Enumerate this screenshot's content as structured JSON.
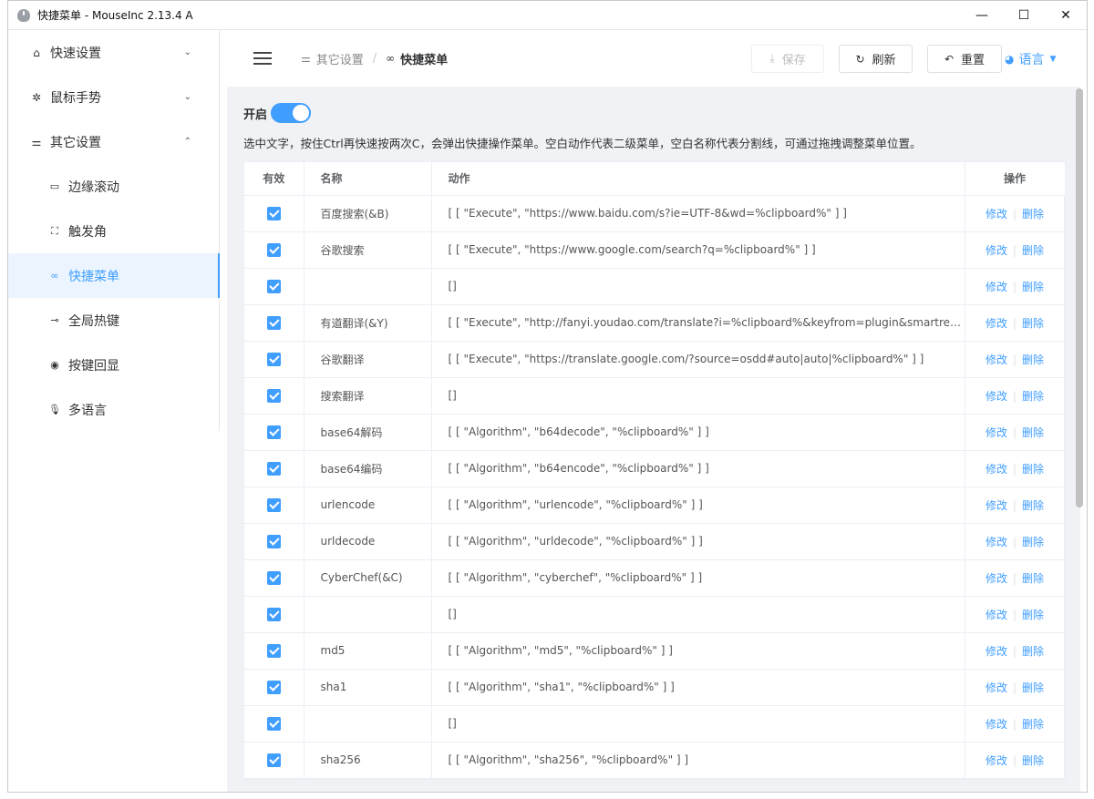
{
  "window": {
    "title": "快捷菜单 - MouseInc 2.13.4 A",
    "min": "—",
    "max": "☐",
    "close": "✕"
  },
  "sidebar": {
    "items": [
      {
        "label": "快速设置",
        "icon": "home-icon",
        "glyph": "⌂",
        "chevron": "⌄"
      },
      {
        "label": "鼠标手势",
        "icon": "gear-icon",
        "glyph": "✲",
        "chevron": "⌄"
      },
      {
        "label": "其它设置",
        "icon": "sliders-icon",
        "glyph": "⚌",
        "chevron": "⌃"
      }
    ],
    "subitems": [
      {
        "label": "边缘滚动",
        "icon": "monitor-icon",
        "glyph": "▭"
      },
      {
        "label": "触发角",
        "icon": "corners-icon",
        "glyph": "⛶"
      },
      {
        "label": "快捷菜单",
        "icon": "link-icon",
        "glyph": "∞"
      },
      {
        "label": "全局热键",
        "icon": "key-icon",
        "glyph": "⊸"
      },
      {
        "label": "按键回显",
        "icon": "eye-icon",
        "glyph": "◉"
      },
      {
        "label": "多语言",
        "icon": "microphone-icon",
        "glyph": "🎙"
      }
    ]
  },
  "header": {
    "breadcrumb": {
      "parent": "其它设置",
      "current": "快捷菜单",
      "separator": "/"
    },
    "buttons": {
      "save": "保存",
      "refresh": "刷新",
      "reset": "重置"
    },
    "language": "语言"
  },
  "main": {
    "toggle_label": "开启",
    "toggle_on": true,
    "description": "选中文字，按住Ctrl再快速按两次C，会弹出快捷操作菜单。空白动作代表二级菜单，空白名称代表分割线，可通过拖拽调整菜单位置。",
    "table": {
      "headers": {
        "valid": "有效",
        "name": "名称",
        "action": "动作",
        "ops": "操作"
      },
      "edit_label": "修改",
      "delete_label": "删除",
      "rows": [
        {
          "name": "百度搜索(&B)",
          "action": "[ [ \"Execute\", \"https://www.baidu.com/s?ie=UTF-8&wd=%clipboard%\" ] ]"
        },
        {
          "name": "谷歌搜索",
          "action": "[ [ \"Execute\", \"https://www.google.com/search?q=%clipboard%\" ] ]"
        },
        {
          "name": "",
          "action": "[]"
        },
        {
          "name": "有道翻译(&Y)",
          "action": "[ [ \"Execute\", \"http://fanyi.youdao.com/translate?i=%clipboard%&keyfrom=plugin&smartresult=dict&s…"
        },
        {
          "name": "谷歌翻译",
          "action": "[ [ \"Execute\", \"https://translate.google.com/?source=osdd#auto|auto|%clipboard%\" ] ]"
        },
        {
          "name": "搜索翻译",
          "action": "[]"
        },
        {
          "name": "base64解码",
          "action": "[ [ \"Algorithm\", \"b64decode\", \"%clipboard%\" ] ]"
        },
        {
          "name": "base64编码",
          "action": "[ [ \"Algorithm\", \"b64encode\", \"%clipboard%\" ] ]"
        },
        {
          "name": "urlencode",
          "action": "[ [ \"Algorithm\", \"urlencode\", \"%clipboard%\" ] ]"
        },
        {
          "name": "urldecode",
          "action": "[ [ \"Algorithm\", \"urldecode\", \"%clipboard%\" ] ]"
        },
        {
          "name": "CyberChef(&C)",
          "action": "[ [ \"Algorithm\", \"cyberchef\", \"%clipboard%\" ] ]"
        },
        {
          "name": "",
          "action": "[]"
        },
        {
          "name": "md5",
          "action": "[ [ \"Algorithm\", \"md5\", \"%clipboard%\" ] ]"
        },
        {
          "name": "sha1",
          "action": "[ [ \"Algorithm\", \"sha1\", \"%clipboard%\" ] ]"
        },
        {
          "name": "",
          "action": "[]"
        },
        {
          "name": "sha256",
          "action": "[ [ \"Algorithm\", \"sha256\", \"%clipboard%\" ] ]"
        }
      ]
    }
  },
  "colors": {
    "accent": "#409eff",
    "content_bg": "#f0f2f5",
    "active_bg": "#ecf5ff"
  }
}
